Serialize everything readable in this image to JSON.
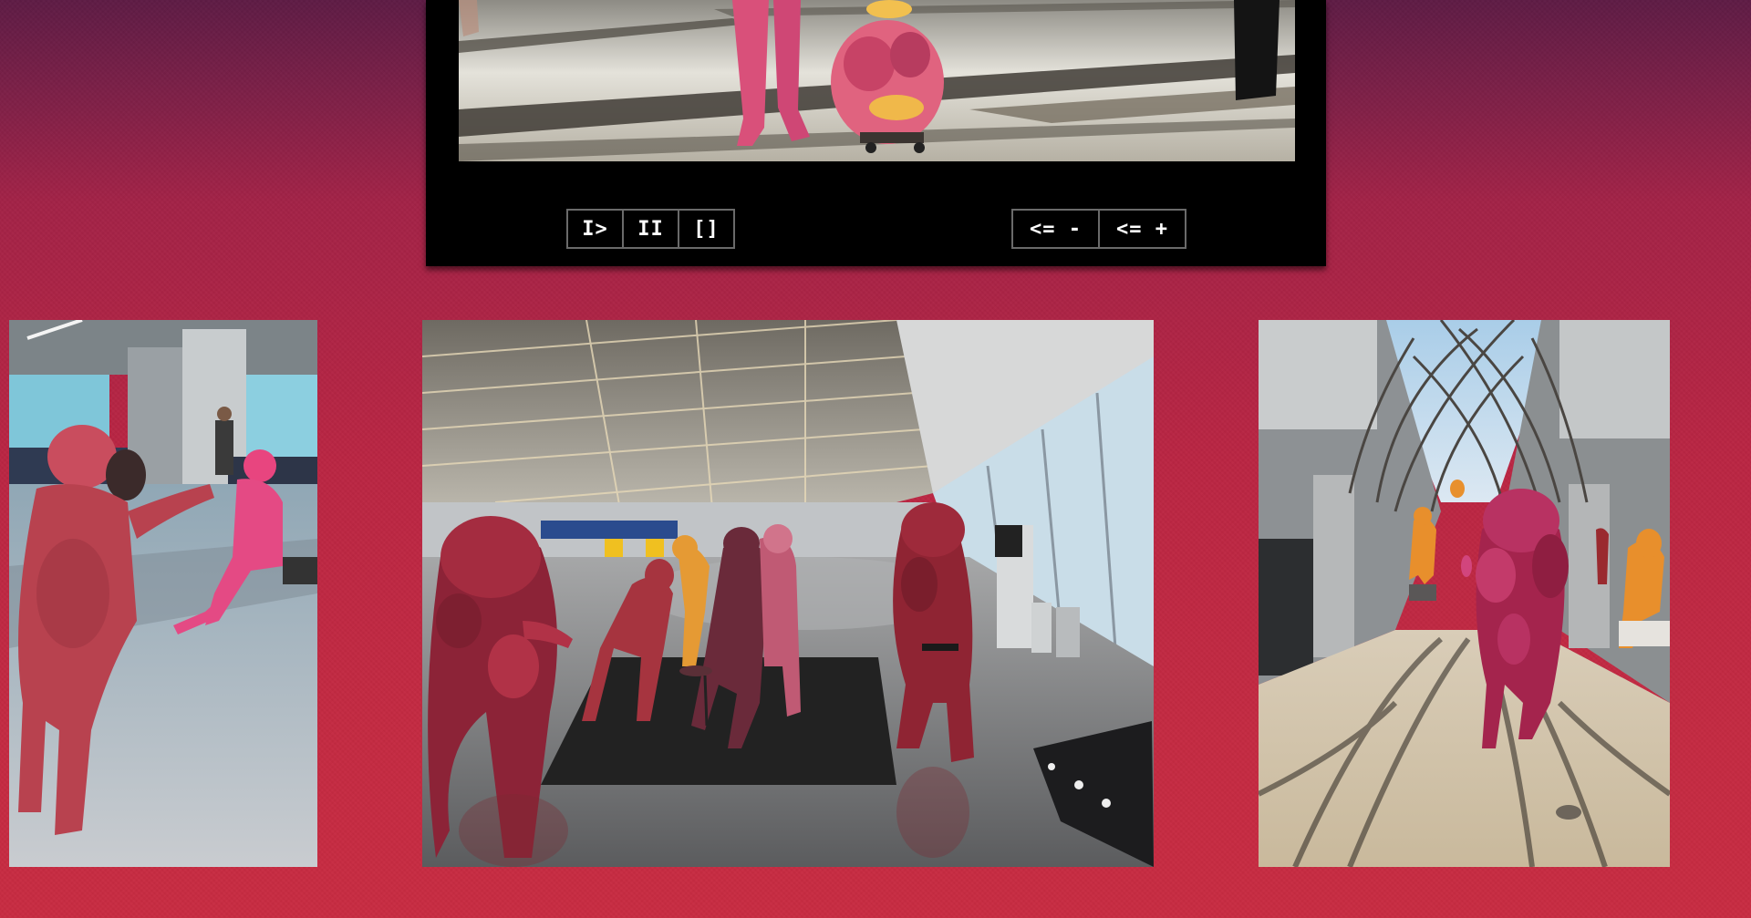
{
  "player": {
    "controls": {
      "play_label": "I>",
      "pause_label": "II",
      "fullscreen_label": "[]",
      "rewind_slower_label": "<= -",
      "rewind_faster_label": "<= +"
    }
  },
  "gallery": {
    "images": [
      {
        "name": "airport-gate-figures"
      },
      {
        "name": "terminal-hall-figures"
      },
      {
        "name": "walkway-figures"
      }
    ]
  },
  "colors": {
    "background_top": "#5e1b45",
    "background_bottom": "#c82c42",
    "player_bg": "#000000",
    "button_border": "#6a6a6a",
    "button_text": "#ffffff"
  }
}
